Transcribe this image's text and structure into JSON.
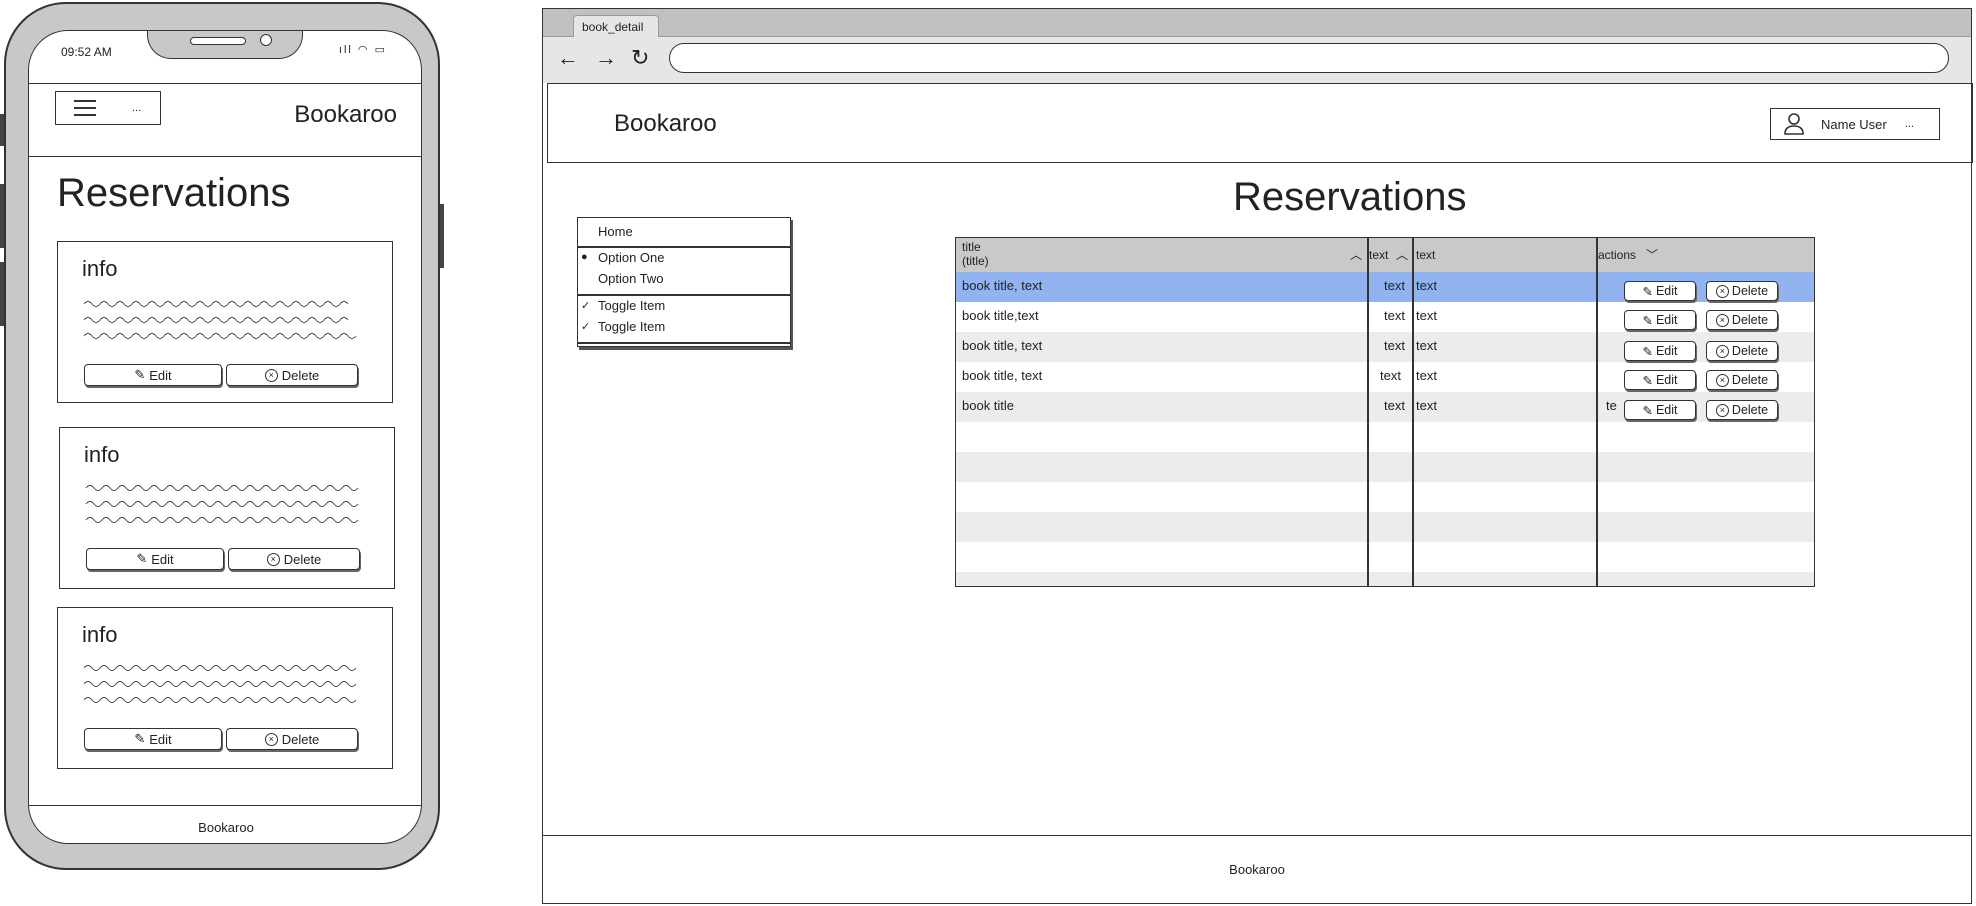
{
  "mobile": {
    "status_time": "09:52 AM",
    "menu_dots": "...",
    "brand": "Bookaroo",
    "page_title": "Reservations",
    "cards": [
      {
        "heading": "info",
        "edit_label": "Edit",
        "delete_label": "Delete"
      },
      {
        "heading": "info",
        "edit_label": "Edit",
        "delete_label": "Delete"
      },
      {
        "heading": "info",
        "edit_label": "Edit",
        "delete_label": "Delete"
      }
    ],
    "footer": "Bookaroo"
  },
  "browser": {
    "tab_label": "book_detail",
    "url": "",
    "brand": "Bookaroo",
    "user_name": "Name User",
    "user_menu_dots": "...",
    "page_title": "Reservations",
    "nav_menu": {
      "home": "Home",
      "option_one": "Option One",
      "option_two": "Option Two",
      "toggle_1": "Toggle Item",
      "toggle_2": "Toggle Item"
    },
    "table": {
      "headers": {
        "title_line1": "title",
        "title_line2": "(title)",
        "col2": "text",
        "col3": "text",
        "actions": "actions"
      },
      "rows": [
        {
          "title": "book title, text",
          "c2": "text",
          "c3": "text",
          "selected": true
        },
        {
          "title": "book title,text",
          "c2": "text",
          "c3": "text"
        },
        {
          "title": "book title, text",
          "c2": "text",
          "c3": "text"
        },
        {
          "title": "book title, text",
          "c2": "text",
          "c3": "text"
        },
        {
          "title": "book title",
          "c2": "text",
          "c3": "text",
          "c4_fragment": "te"
        }
      ],
      "edit_label": "Edit",
      "delete_label": "Delete"
    },
    "footer": "Bookaroo"
  },
  "colors": {
    "selected_row": "#91b4f0",
    "stripe": "#ececec",
    "header_bg": "#c9c9c9",
    "device_frame": "#c8c8c8"
  }
}
